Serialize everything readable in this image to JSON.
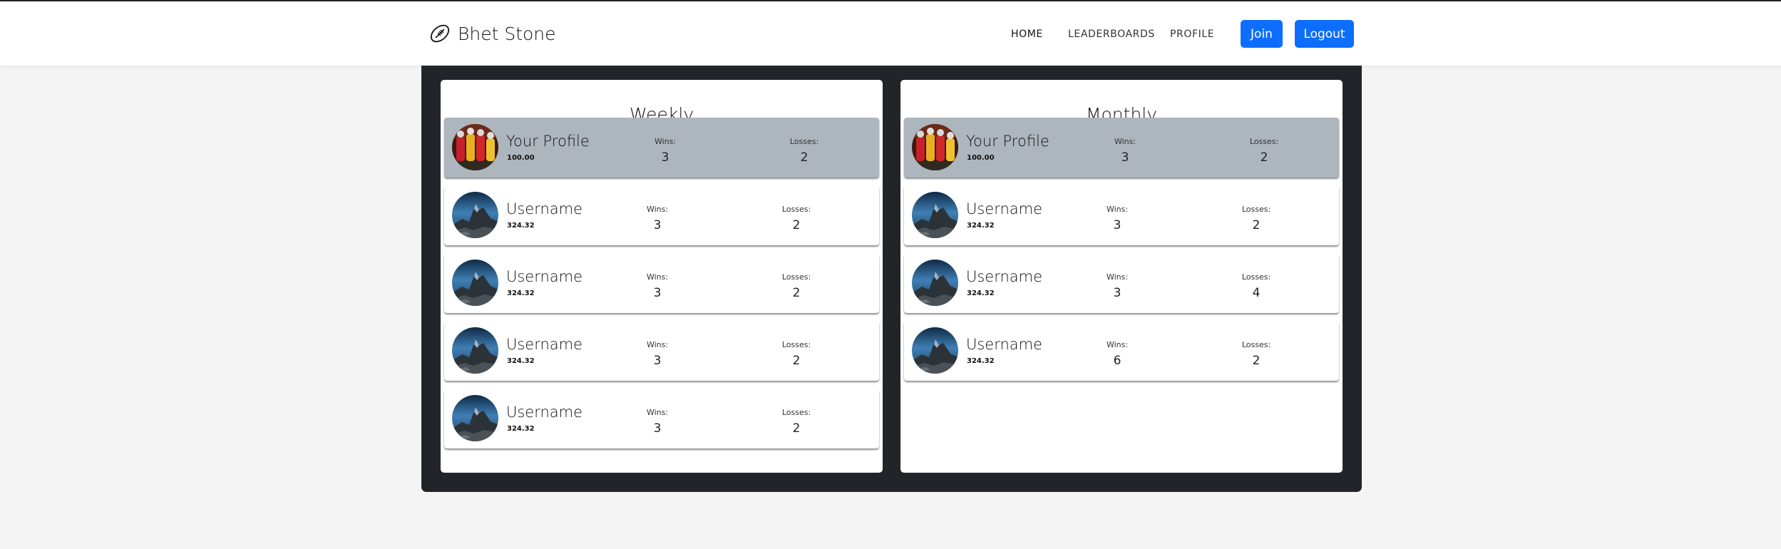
{
  "header": {
    "brand": "Bhet Stone",
    "brand_icon": "football-icon",
    "nav": [
      {
        "label": "HOME"
      },
      {
        "label": "LEADERBOARDS"
      },
      {
        "label": "PROFILE"
      }
    ],
    "join_label": "Join",
    "logout_label": "Logout",
    "accent": "#0d6efd"
  },
  "boards": [
    {
      "title": "Weekly",
      "rows": [
        {
          "name": "Your Profile",
          "score": "100.00",
          "wins_label": "Wins:",
          "wins": "3",
          "losses_label": "Losses:",
          "losses": "2",
          "highlight": true,
          "avatar": "team-photo-avatar"
        },
        {
          "name": "Username",
          "score": "324.32",
          "wins_label": "Wins:",
          "wins": "3",
          "losses_label": "Losses:",
          "losses": "2",
          "highlight": false,
          "avatar": "mountain-avatar"
        },
        {
          "name": "Username",
          "score": "324.32",
          "wins_label": "Wins:",
          "wins": "3",
          "losses_label": "Losses:",
          "losses": "2",
          "highlight": false,
          "avatar": "mountain-avatar"
        },
        {
          "name": "Username",
          "score": "324.32",
          "wins_label": "Wins:",
          "wins": "3",
          "losses_label": "Losses:",
          "losses": "2",
          "highlight": false,
          "avatar": "mountain-avatar"
        },
        {
          "name": "Username",
          "score": "324.32",
          "wins_label": "Wins:",
          "wins": "3",
          "losses_label": "Losses:",
          "losses": "2",
          "highlight": false,
          "avatar": "mountain-avatar"
        }
      ]
    },
    {
      "title": "Monthly",
      "rows": [
        {
          "name": "Your Profile",
          "score": "100.00",
          "wins_label": "Wins:",
          "wins": "3",
          "losses_label": "Losses:",
          "losses": "2",
          "highlight": true,
          "avatar": "team-photo-avatar"
        },
        {
          "name": "Username",
          "score": "324.32",
          "wins_label": "Wins:",
          "wins": "3",
          "losses_label": "Losses:",
          "losses": "2",
          "highlight": false,
          "avatar": "mountain-avatar"
        },
        {
          "name": "Username",
          "score": "324.32",
          "wins_label": "Wins:",
          "wins": "3",
          "losses_label": "Losses:",
          "losses": "4",
          "highlight": false,
          "avatar": "mountain-avatar"
        },
        {
          "name": "Username",
          "score": "324.32",
          "wins_label": "Wins:",
          "wins": "6",
          "losses_label": "Losses:",
          "losses": "2",
          "highlight": false,
          "avatar": "mountain-avatar"
        }
      ]
    }
  ]
}
